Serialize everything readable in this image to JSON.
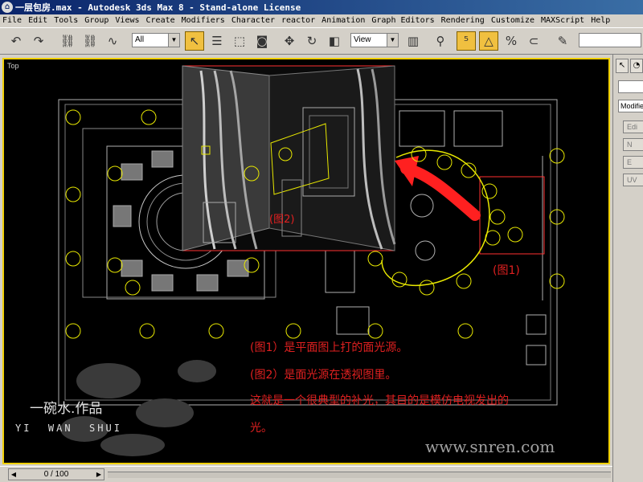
{
  "window": {
    "title": "一层包房.max - Autodesk 3ds Max 8  - Stand-alone License"
  },
  "menu": [
    "File",
    "Edit",
    "Tools",
    "Group",
    "Views",
    "Create",
    "Modifiers",
    "Character",
    "reactor",
    "Animation",
    "Graph Editors",
    "Rendering",
    "Customize",
    "MAXScript",
    "Help"
  ],
  "toolbar": {
    "selection_filter": "All",
    "ref_coord": "View"
  },
  "viewport": {
    "label": "Top",
    "border_color": "#f0d000"
  },
  "annotations": {
    "fig2_label": "(图2)",
    "fig1_label": "(图1)",
    "line1": "(图1）是平面图上打的面光源。",
    "line2": "(图2）是面光源在透视图里。",
    "line3": "这就是一个很典型的补光，其目的是模仿电视发出的",
    "line4": "光。"
  },
  "signature": {
    "title": "一碗水.作品",
    "pinyin": "YI  WAN  SHUI"
  },
  "watermark": "www.snren.com",
  "command_panel": {
    "field_text": "Modifier",
    "buttons": [
      "Edi",
      "N",
      "E",
      "UV"
    ]
  },
  "timeslider": {
    "value": "0 / 100"
  },
  "colors": {
    "light": "#e8e800",
    "highlight": "#ff0000",
    "wall": "#c0c0c0"
  }
}
